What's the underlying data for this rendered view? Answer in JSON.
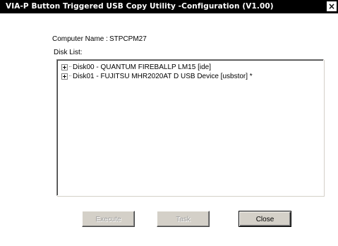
{
  "window": {
    "title": "VIA-P Button Triggered USB Copy Utility -Configuration (V1.00)",
    "close_glyph": "×"
  },
  "computer": {
    "label": "Computer Name :",
    "value": "STPCPM27"
  },
  "disk_list": {
    "label": "Disk List:",
    "items": [
      {
        "label": "Disk00 - QUANTUM FIREBALLP LM15 [ide]"
      },
      {
        "label": "Disk01 - FUJITSU MHR2020AT  D USB Device [usbstor] *"
      }
    ]
  },
  "buttons": {
    "execute": "Execute",
    "task": "Task",
    "close": "Close"
  }
}
